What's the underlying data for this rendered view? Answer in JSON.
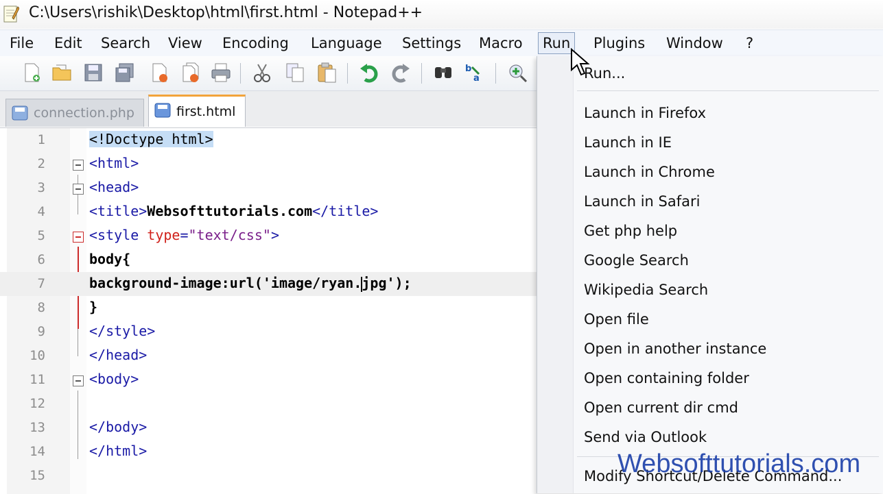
{
  "window": {
    "title": "C:\\Users\\rishik\\Desktop\\html\\first.html - Notepad++",
    "icon": "notepad-icon"
  },
  "menubar": {
    "items": [
      {
        "label": "File"
      },
      {
        "label": "Edit"
      },
      {
        "label": "Search"
      },
      {
        "label": "View"
      },
      {
        "label": "Encoding"
      },
      {
        "label": "Language"
      },
      {
        "label": "Settings"
      },
      {
        "label": "Macro"
      },
      {
        "label": "Run",
        "active": true
      },
      {
        "label": "Plugins"
      },
      {
        "label": "Window"
      },
      {
        "label": "?"
      }
    ]
  },
  "toolbar": {
    "icons": [
      "new-file-icon",
      "open-file-icon",
      "save-icon",
      "save-all-icon",
      "close-icon",
      "close-all-icon",
      "print-icon",
      "cut-icon",
      "copy-icon",
      "paste-icon",
      "undo-icon",
      "redo-icon",
      "find-icon",
      "replace-icon",
      "zoom-in-icon"
    ]
  },
  "tabs": [
    {
      "label": "connection.php",
      "active": false
    },
    {
      "label": "first.html",
      "active": true
    }
  ],
  "editor": {
    "line_numbers": [
      "1",
      "2",
      "3",
      "4",
      "5",
      "6",
      "7",
      "8",
      "9",
      "10",
      "11",
      "12",
      "13",
      "14",
      "15"
    ],
    "lines": {
      "l1": "<!Doctype html>",
      "l2": "<html>",
      "l3": "<head>",
      "l4_open": "<title>",
      "l4_text": "Websofttutorials.com",
      "l4_close": "</title>",
      "l5_open": "<style ",
      "l5_attr": "type",
      "l5_eq": "=",
      "l5_val": "\"text/css\"",
      "l5_close": ">",
      "l6": "body{",
      "l7_a": "background-image:url('image/ryan.",
      "l7_b": "jpg');",
      "l8": "}",
      "l9": "</style>",
      "l10": "</head>",
      "l11": "<body>",
      "l12": "",
      "l13": "</body>",
      "l14": "</html>",
      "l15": ""
    }
  },
  "run_menu": {
    "items": [
      "Run...",
      "Launch in Firefox",
      "Launch in IE",
      "Launch in Chrome",
      "Launch in Safari",
      "Get php help",
      "Google Search",
      "Wikipedia Search",
      "Open file",
      "Open in another instance",
      "Open containing folder",
      "Open current dir cmd",
      "Send via Outlook",
      "Modify Shortcut/Delete Command..."
    ]
  },
  "watermark": "Websofttutorials.com",
  "colors": {
    "tag": "#1a1aa6",
    "attribute": "#d0211b",
    "string": "#7a1f8a",
    "active_tab_accent": "#f2a33a"
  }
}
